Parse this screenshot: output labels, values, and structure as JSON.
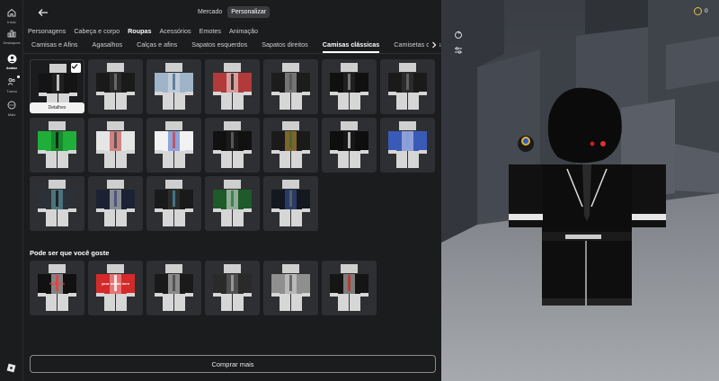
{
  "nav": {
    "items": [
      {
        "label": "Início",
        "icon": "home-icon"
      },
      {
        "label": "Destaques",
        "icon": "charts-icon"
      },
      {
        "label": "Avatar",
        "icon": "avatar-icon"
      },
      {
        "label": "Turma",
        "icon": "friends-icon"
      },
      {
        "label": "Mais",
        "icon": "more-icon"
      }
    ]
  },
  "topbar": {
    "marketplace": "Mercado",
    "customize": "Personalizar"
  },
  "categories": [
    "Personagens",
    "Cabeça e corpo",
    "Roupas",
    "Acessórios",
    "Emotes",
    "Animação"
  ],
  "subcategories": [
    "Camisas e Afins",
    "Agasalhos",
    "Calças e afins",
    "Sapatos esquerdos",
    "Sapatos direitos",
    "Camisas clássicas",
    "Camisetas clássic"
  ],
  "grid": {
    "details_label": "Detalhes",
    "items": [
      {
        "colors": [
          "#141414",
          "#2a2a2a",
          "#e8e8e8"
        ]
      },
      {
        "colors": [
          "#1a1a1a",
          "#3a3a3a",
          "#777"
        ]
      },
      {
        "colors": [
          "#9fb4c9",
          "#d9dfe5",
          "#4e6a8a"
        ]
      },
      {
        "colors": [
          "#b23a3a",
          "#f0f0f0",
          "#1a1a1a"
        ]
      },
      {
        "colors": [
          "#1c1c1c",
          "#bdbdbd",
          "#555"
        ]
      },
      {
        "colors": [
          "#101010",
          "#2b2b2b",
          "#8a8a8a"
        ]
      },
      {
        "colors": [
          "#1a1a1a",
          "#3b3b3b",
          "#6b6b6b"
        ]
      },
      {
        "colors": [
          "#1fae3a",
          "#0d6d20",
          "#111"
        ]
      },
      {
        "colors": [
          "#e6e6e6",
          "#c03030",
          "#444"
        ]
      },
      {
        "colors": [
          "#f2f2f2",
          "#3a63c9",
          "#c44"
        ]
      },
      {
        "colors": [
          "#111",
          "#222",
          "#666"
        ]
      },
      {
        "colors": [
          "#1a1a1a",
          "#d2a23a",
          "#3a6a3a"
        ]
      },
      {
        "colors": [
          "#0e0e0e",
          "#1f1f1f",
          "#ddd"
        ]
      },
      {
        "colors": [
          "#3a5ab8",
          "#d8d8f0",
          "#7aa0e0"
        ]
      },
      {
        "colors": [
          "#2b3136",
          "#6aa8b8",
          "#111"
        ]
      },
      {
        "colors": [
          "#1b2233",
          "#e6e6e6",
          "#3a4a70"
        ]
      },
      {
        "colors": [
          "#1a1a1a",
          "#3a3a3a",
          "#4a8a9a"
        ]
      },
      {
        "colors": [
          "#1e5a2a",
          "#f0f0f0",
          "#2a7a3a"
        ]
      },
      {
        "colors": [
          "#14181f",
          "#3a5aa0",
          "#666"
        ]
      }
    ]
  },
  "recommend": {
    "title": "Pode ser que você goste",
    "items": [
      {
        "colors": [
          "#111",
          "#e0e0e0",
          "#ff3333"
        ],
        "text": "ROBLOX"
      },
      {
        "colors": [
          "#d42a2a",
          "#f4b0b0",
          "#ffffff"
        ],
        "text": "your words here"
      },
      {
        "colors": [
          "#1a1a1a",
          "#e8e8e8",
          "#444"
        ],
        "text": ""
      },
      {
        "colors": [
          "#2a2a2a",
          "#6b6b6b",
          "#aaa"
        ],
        "text": ""
      },
      {
        "colors": [
          "#8f8f8f",
          "#dcdcdc",
          "#555"
        ],
        "text": ""
      },
      {
        "colors": [
          "#151515",
          "#d0d0d0",
          "#b32"
        ],
        "text": ""
      }
    ]
  },
  "buy_more": "Comprar mais",
  "robux_amount": "0",
  "colors": {
    "bg": "#1b1c1e",
    "tile": "#2e2f32",
    "scene_sky": "#3a3d44",
    "scene_floor": "#8f9296"
  }
}
